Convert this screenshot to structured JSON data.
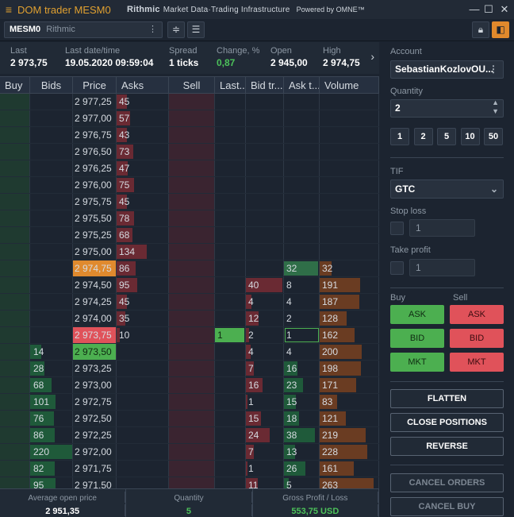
{
  "title": {
    "menu_icon": "hamburger-icon",
    "text": "DOM trader MESM0",
    "brand": "Rithmic",
    "brand_sub": "Market Data·Trading Infrastructure",
    "powered": "Powered by OMNE™"
  },
  "toolbar": {
    "symbol": "MESM0",
    "connection": "Rithmic",
    "menu": "⋮"
  },
  "stats": [
    {
      "label": "Last",
      "value": "2 973,75"
    },
    {
      "label": "Last date/time",
      "value": "19.05.2020 09:59:04"
    },
    {
      "label": "Spread",
      "value": "1 ticks"
    },
    {
      "label": "Change, %",
      "value": "0,87"
    },
    {
      "label": "Open",
      "value": "2 945,00"
    },
    {
      "label": "High",
      "value": "2 974,75"
    }
  ],
  "columns": [
    "Buy",
    "Bids",
    "Price",
    "Asks",
    "Sell",
    "Last...",
    "Bid tr...",
    "Ask t...",
    "Volume"
  ],
  "colors": {
    "bid_bar": "#1f5a3a",
    "ask_bar": "#6a2a33",
    "volume_bar": "#6a3c22",
    "last_price": "#e0525a",
    "best_bid": "#4caf50",
    "high_price": "#e08a2e",
    "last_trade": "#4caf50"
  },
  "rows": [
    {
      "price": "2 977,25",
      "ask": "45",
      "ask_fill": 0.2
    },
    {
      "price": "2 977,00",
      "ask": "57",
      "ask_fill": 0.25
    },
    {
      "price": "2 976,75",
      "ask": "43",
      "ask_fill": 0.2
    },
    {
      "price": "2 976,50",
      "ask": "73",
      "ask_fill": 0.32
    },
    {
      "price": "2 976,25",
      "ask": "47",
      "ask_fill": 0.21
    },
    {
      "price": "2 976,00",
      "ask": "75",
      "ask_fill": 0.33
    },
    {
      "price": "2 975,75",
      "ask": "45",
      "ask_fill": 0.2
    },
    {
      "price": "2 975,50",
      "ask": "78",
      "ask_fill": 0.34
    },
    {
      "price": "2 975,25",
      "ask": "68",
      "ask_fill": 0.3
    },
    {
      "price": "2 975,00",
      "ask": "134",
      "ask_fill": 0.58
    },
    {
      "price": "2 974,75",
      "ask": "86",
      "ask_fill": 0.37,
      "price_hl": "high",
      "ask_trade": "32",
      "volume": "32",
      "vol_fill": 0.22,
      "at_hl": "green"
    },
    {
      "price": "2 974,50",
      "ask": "95",
      "ask_fill": 0.4,
      "bid_trade": "40",
      "bt_fill": 1.0,
      "ask_trade": "8",
      "volume": "191",
      "vol_fill": 0.75
    },
    {
      "price": "2 974,25",
      "ask": "45",
      "ask_fill": 0.2,
      "bid_trade": "4",
      "bt_fill": 0.15,
      "ask_trade": "4",
      "volume": "187",
      "vol_fill": 0.73
    },
    {
      "price": "2 974,00",
      "ask": "35",
      "ask_fill": 0.16,
      "bid_trade": "12",
      "bt_fill": 0.35,
      "ask_trade": "2",
      "volume": "128",
      "vol_fill": 0.5
    },
    {
      "price": "2 973,75",
      "ask": "10",
      "ask_fill": 0.06,
      "price_hl": "last",
      "last": "1",
      "bid_trade": "2",
      "bt_fill": 0.08,
      "ask_trade": "1",
      "at_box": true,
      "volume": "162",
      "vol_fill": 0.64
    },
    {
      "price": "2 973,50",
      "bid": "14",
      "bid_fill": 0.25,
      "price_hl": "bid",
      "bid_trade": "4",
      "bt_fill": 0.12,
      "ask_trade": "4",
      "volume": "200",
      "vol_fill": 0.78
    },
    {
      "price": "2 973,25",
      "bid": "28",
      "bid_fill": 0.33,
      "bid_trade": "7",
      "bt_fill": 0.22,
      "ask_trade": "16",
      "at_fill": 0.4,
      "volume": "198",
      "vol_fill": 0.77
    },
    {
      "price": "2 973,00",
      "bid": "68",
      "bid_fill": 0.5,
      "bid_trade": "16",
      "bt_fill": 0.45,
      "ask_trade": "23",
      "at_fill": 0.55,
      "volume": "171",
      "vol_fill": 0.67
    },
    {
      "price": "2 972,75",
      "bid": "101",
      "bid_fill": 0.6,
      "bid_trade": "1",
      "bt_fill": 0.05,
      "ask_trade": "15",
      "at_fill": 0.35,
      "volume": "83",
      "vol_fill": 0.33
    },
    {
      "price": "2 972,50",
      "bid": "76",
      "bid_fill": 0.55,
      "bid_trade": "15",
      "bt_fill": 0.42,
      "ask_trade": "18",
      "at_fill": 0.45,
      "volume": "121",
      "vol_fill": 0.48
    },
    {
      "price": "2 972,25",
      "bid": "86",
      "bid_fill": 0.58,
      "bid_trade": "24",
      "bt_fill": 0.65,
      "ask_trade": "38",
      "at_fill": 0.9,
      "volume": "219",
      "vol_fill": 0.85
    },
    {
      "price": "2 972,00",
      "bid": "220",
      "bid_fill": 1.0,
      "bid_trade": "7",
      "bt_fill": 0.22,
      "ask_trade": "13",
      "at_fill": 0.32,
      "volume": "228",
      "vol_fill": 0.88
    },
    {
      "price": "2 971,75",
      "bid": "82",
      "bid_fill": 0.57,
      "bid_trade": "1",
      "bt_fill": 0.05,
      "ask_trade": "26",
      "at_fill": 0.62,
      "volume": "161",
      "vol_fill": 0.63
    },
    {
      "price": "2 971,50",
      "bid": "95",
      "bid_fill": 0.6,
      "bid_trade": "11",
      "bt_fill": 0.32,
      "ask_trade": "5",
      "at_fill": 0.14,
      "volume": "263",
      "vol_fill": 1.0
    }
  ],
  "footer": [
    {
      "label": "Average open price",
      "value": "2 951,35"
    },
    {
      "label": "Quantity",
      "value": "5"
    },
    {
      "label": "Gross Profit / Loss",
      "value": "553,75 USD"
    }
  ],
  "panel": {
    "account_label": "Account",
    "account": "SebastianKozlovOU...",
    "quantity_label": "Quantity",
    "quantity": "2",
    "quick_qty": [
      "1",
      "2",
      "5",
      "10",
      "50"
    ],
    "tif_label": "TIF",
    "tif": "GTC",
    "stop_loss_label": "Stop loss",
    "stop_loss": "1",
    "take_profit_label": "Take profit",
    "take_profit": "1",
    "buy_label": "Buy",
    "sell_label": "Sell",
    "buy_ask": "ASK",
    "sell_ask": "ASK",
    "buy_bid": "BID",
    "sell_bid": "BID",
    "buy_mkt": "MKT",
    "sell_mkt": "MKT",
    "flatten": "FLATTEN",
    "close_positions": "CLOSE POSITIONS",
    "reverse": "REVERSE",
    "cancel_orders": "CANCEL ORDERS",
    "cancel_buy": "CANCEL BUY"
  }
}
